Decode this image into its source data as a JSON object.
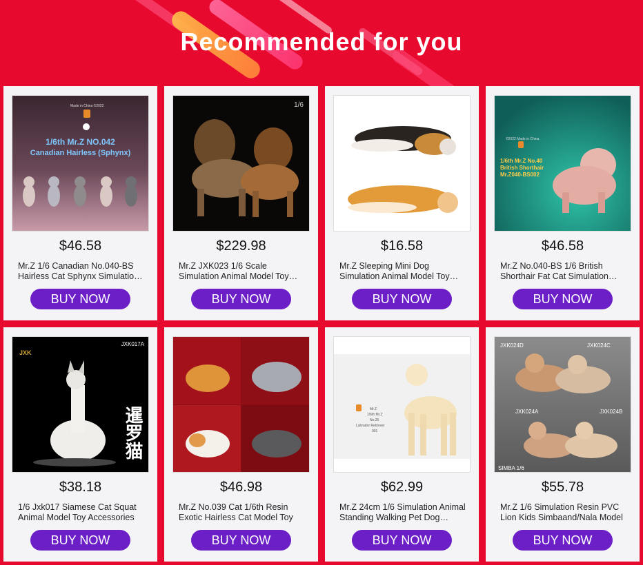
{
  "title": "Recommended for you",
  "accent_color": "#e8092e",
  "button_color": "#6d1fc7",
  "products": [
    {
      "price": "$46.58",
      "name": "Mr.Z 1/6 Canadian No.040-BS Hairless Cat Sphynx Simulation Animal Model",
      "button": "BUY NOW",
      "image_text": {
        "made": "Made in China ©2022",
        "line1": "1/6th Mr.Z NO.042",
        "line2": "Canadian Hairless (Sphynx)"
      }
    },
    {
      "price": "$229.98",
      "name": "Mr.Z JXK023 1/6 Scale Simulation Animal Model Toy Lion",
      "button": "BUY NOW",
      "image_text": {
        "scale": "1/6"
      }
    },
    {
      "price": "$16.58",
      "name": "Mr.Z Sleeping Mini Dog Simulation Animal Model Toy Corgi",
      "button": "BUY NOW",
      "image_text": {}
    },
    {
      "price": "$46.58",
      "name": "Mr.Z No.040-BS 1/6 British Shorthair Fat Cat Simulation Animal Model",
      "button": "BUY NOW",
      "image_text": {
        "made": "©2022 Made in China",
        "line1": "1/6th Mr.Z No.40",
        "line2": "British Shorthair",
        "line3": "Mr.Z040-BS002"
      }
    },
    {
      "price": "$38.18",
      "name": "1/6 Jxk017 Siamese Cat Squat Animal Model Toy Accessories",
      "button": "BUY NOW",
      "image_text": {
        "code": "JXK017A",
        "brand": "JXK",
        "cn": "暹罗猫"
      }
    },
    {
      "price": "$46.98",
      "name": "Mr.Z No.039 Cat 1/6th Resin Exotic Hairless Cat Model Toy",
      "button": "BUY NOW",
      "image_text": {}
    },
    {
      "price": "$62.99",
      "name": "Mr.Z 24cm 1/6 Simulation Animal Standing Walking Pet Dog Labrador",
      "button": "BUY NOW",
      "image_text": {
        "line1": "Mr.Z",
        "line2": "1/6th Mr.Z",
        "line3": "No.25",
        "line4": "Labrador Retriever",
        "line5": "001"
      }
    },
    {
      "price": "$55.78",
      "name": "Mr.Z 1/6 Simulation Resin PVC Lion Kids Simbaand/Nala Model",
      "button": "BUY NOW",
      "image_text": {
        "a": "JXK024D",
        "b": "JXK024C",
        "c": "JXK024A",
        "d": "JXK024B",
        "e": "SIMBA 1/6"
      }
    }
  ]
}
